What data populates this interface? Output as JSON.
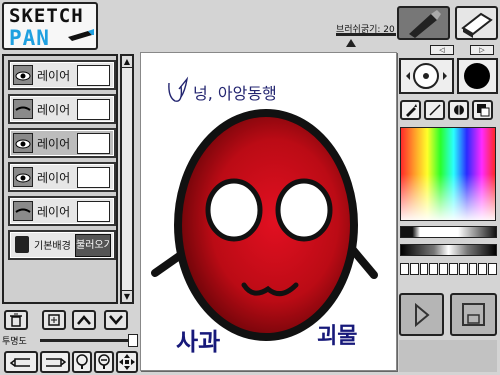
{
  "app": {
    "logo_line1": "SKETCH",
    "logo_line2": "PAN",
    "accent_color": "#1fa0e0"
  },
  "layers": {
    "items": [
      {
        "label": "레이어",
        "active": false,
        "eye_icon": "eye-icon"
      },
      {
        "label": "레이어",
        "active": false,
        "eye_icon": "eye-closed-icon"
      },
      {
        "label": "레이어",
        "active": true,
        "eye_icon": "eye-icon"
      },
      {
        "label": "레이어",
        "active": false,
        "eye_icon": "eye-icon"
      },
      {
        "label": "레이어",
        "active": false,
        "eye_icon": "eye-closed-icon"
      }
    ],
    "background": {
      "label": "기본배경",
      "load_label": "불러오기",
      "icon": "lock-icon"
    }
  },
  "layer_actions": {
    "delete_icon": "trash-icon",
    "add_icon": "add-layer-icon",
    "up_icon": "arrow-up-icon",
    "down_icon": "arrow-down-icon"
  },
  "opacity": {
    "label": "투명도",
    "value": 1.0
  },
  "brush": {
    "size_label": "브러쉬굵기: 20",
    "size": 20
  },
  "canvas": {
    "handwriting_top": "넝, 아앙동행",
    "caption_left": "사과",
    "caption_right": "괴물",
    "face_color": "#cc0b18",
    "caption_color": "#17197a"
  },
  "right_panel": {
    "tools": [
      "brush-icon",
      "line-icon",
      "fill-icon",
      "layers-mode-icon"
    ],
    "current_color": "#000000"
  }
}
